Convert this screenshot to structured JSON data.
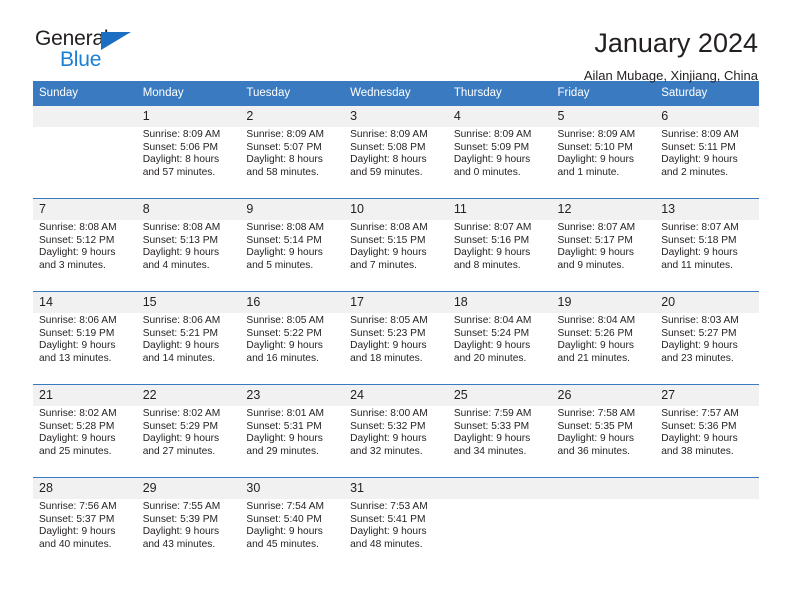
{
  "brand": {
    "line1": "General",
    "line2": "Blue",
    "triangle_color": "#1b6ec2",
    "line2_color": "#1b7fd4"
  },
  "header": {
    "title": "January 2024",
    "location": "Ailan Mubage, Xinjiang, China",
    "header_bg": "#3a7ac0",
    "date_cell_bg": "#f1f1f1"
  },
  "calendar": {
    "weekday_headers": [
      "Sunday",
      "Monday",
      "Tuesday",
      "Wednesday",
      "Thursday",
      "Friday",
      "Saturday"
    ],
    "weeks": [
      [
        {
          "day": "",
          "sunrise": "",
          "sunset": "",
          "daylight_1": "",
          "daylight_2": ""
        },
        {
          "day": "1",
          "sunrise": "Sunrise: 8:09 AM",
          "sunset": "Sunset: 5:06 PM",
          "daylight_1": "Daylight: 8 hours",
          "daylight_2": "and 57 minutes."
        },
        {
          "day": "2",
          "sunrise": "Sunrise: 8:09 AM",
          "sunset": "Sunset: 5:07 PM",
          "daylight_1": "Daylight: 8 hours",
          "daylight_2": "and 58 minutes."
        },
        {
          "day": "3",
          "sunrise": "Sunrise: 8:09 AM",
          "sunset": "Sunset: 5:08 PM",
          "daylight_1": "Daylight: 8 hours",
          "daylight_2": "and 59 minutes."
        },
        {
          "day": "4",
          "sunrise": "Sunrise: 8:09 AM",
          "sunset": "Sunset: 5:09 PM",
          "daylight_1": "Daylight: 9 hours",
          "daylight_2": "and 0 minutes."
        },
        {
          "day": "5",
          "sunrise": "Sunrise: 8:09 AM",
          "sunset": "Sunset: 5:10 PM",
          "daylight_1": "Daylight: 9 hours",
          "daylight_2": "and 1 minute."
        },
        {
          "day": "6",
          "sunrise": "Sunrise: 8:09 AM",
          "sunset": "Sunset: 5:11 PM",
          "daylight_1": "Daylight: 9 hours",
          "daylight_2": "and 2 minutes."
        }
      ],
      [
        {
          "day": "7",
          "sunrise": "Sunrise: 8:08 AM",
          "sunset": "Sunset: 5:12 PM",
          "daylight_1": "Daylight: 9 hours",
          "daylight_2": "and 3 minutes."
        },
        {
          "day": "8",
          "sunrise": "Sunrise: 8:08 AM",
          "sunset": "Sunset: 5:13 PM",
          "daylight_1": "Daylight: 9 hours",
          "daylight_2": "and 4 minutes."
        },
        {
          "day": "9",
          "sunrise": "Sunrise: 8:08 AM",
          "sunset": "Sunset: 5:14 PM",
          "daylight_1": "Daylight: 9 hours",
          "daylight_2": "and 5 minutes."
        },
        {
          "day": "10",
          "sunrise": "Sunrise: 8:08 AM",
          "sunset": "Sunset: 5:15 PM",
          "daylight_1": "Daylight: 9 hours",
          "daylight_2": "and 7 minutes."
        },
        {
          "day": "11",
          "sunrise": "Sunrise: 8:07 AM",
          "sunset": "Sunset: 5:16 PM",
          "daylight_1": "Daylight: 9 hours",
          "daylight_2": "and 8 minutes."
        },
        {
          "day": "12",
          "sunrise": "Sunrise: 8:07 AM",
          "sunset": "Sunset: 5:17 PM",
          "daylight_1": "Daylight: 9 hours",
          "daylight_2": "and 9 minutes."
        },
        {
          "day": "13",
          "sunrise": "Sunrise: 8:07 AM",
          "sunset": "Sunset: 5:18 PM",
          "daylight_1": "Daylight: 9 hours",
          "daylight_2": "and 11 minutes."
        }
      ],
      [
        {
          "day": "14",
          "sunrise": "Sunrise: 8:06 AM",
          "sunset": "Sunset: 5:19 PM",
          "daylight_1": "Daylight: 9 hours",
          "daylight_2": "and 13 minutes."
        },
        {
          "day": "15",
          "sunrise": "Sunrise: 8:06 AM",
          "sunset": "Sunset: 5:21 PM",
          "daylight_1": "Daylight: 9 hours",
          "daylight_2": "and 14 minutes."
        },
        {
          "day": "16",
          "sunrise": "Sunrise: 8:05 AM",
          "sunset": "Sunset: 5:22 PM",
          "daylight_1": "Daylight: 9 hours",
          "daylight_2": "and 16 minutes."
        },
        {
          "day": "17",
          "sunrise": "Sunrise: 8:05 AM",
          "sunset": "Sunset: 5:23 PM",
          "daylight_1": "Daylight: 9 hours",
          "daylight_2": "and 18 minutes."
        },
        {
          "day": "18",
          "sunrise": "Sunrise: 8:04 AM",
          "sunset": "Sunset: 5:24 PM",
          "daylight_1": "Daylight: 9 hours",
          "daylight_2": "and 20 minutes."
        },
        {
          "day": "19",
          "sunrise": "Sunrise: 8:04 AM",
          "sunset": "Sunset: 5:26 PM",
          "daylight_1": "Daylight: 9 hours",
          "daylight_2": "and 21 minutes."
        },
        {
          "day": "20",
          "sunrise": "Sunrise: 8:03 AM",
          "sunset": "Sunset: 5:27 PM",
          "daylight_1": "Daylight: 9 hours",
          "daylight_2": "and 23 minutes."
        }
      ],
      [
        {
          "day": "21",
          "sunrise": "Sunrise: 8:02 AM",
          "sunset": "Sunset: 5:28 PM",
          "daylight_1": "Daylight: 9 hours",
          "daylight_2": "and 25 minutes."
        },
        {
          "day": "22",
          "sunrise": "Sunrise: 8:02 AM",
          "sunset": "Sunset: 5:29 PM",
          "daylight_1": "Daylight: 9 hours",
          "daylight_2": "and 27 minutes."
        },
        {
          "day": "23",
          "sunrise": "Sunrise: 8:01 AM",
          "sunset": "Sunset: 5:31 PM",
          "daylight_1": "Daylight: 9 hours",
          "daylight_2": "and 29 minutes."
        },
        {
          "day": "24",
          "sunrise": "Sunrise: 8:00 AM",
          "sunset": "Sunset: 5:32 PM",
          "daylight_1": "Daylight: 9 hours",
          "daylight_2": "and 32 minutes."
        },
        {
          "day": "25",
          "sunrise": "Sunrise: 7:59 AM",
          "sunset": "Sunset: 5:33 PM",
          "daylight_1": "Daylight: 9 hours",
          "daylight_2": "and 34 minutes."
        },
        {
          "day": "26",
          "sunrise": "Sunrise: 7:58 AM",
          "sunset": "Sunset: 5:35 PM",
          "daylight_1": "Daylight: 9 hours",
          "daylight_2": "and 36 minutes."
        },
        {
          "day": "27",
          "sunrise": "Sunrise: 7:57 AM",
          "sunset": "Sunset: 5:36 PM",
          "daylight_1": "Daylight: 9 hours",
          "daylight_2": "and 38 minutes."
        }
      ],
      [
        {
          "day": "28",
          "sunrise": "Sunrise: 7:56 AM",
          "sunset": "Sunset: 5:37 PM",
          "daylight_1": "Daylight: 9 hours",
          "daylight_2": "and 40 minutes."
        },
        {
          "day": "29",
          "sunrise": "Sunrise: 7:55 AM",
          "sunset": "Sunset: 5:39 PM",
          "daylight_1": "Daylight: 9 hours",
          "daylight_2": "and 43 minutes."
        },
        {
          "day": "30",
          "sunrise": "Sunrise: 7:54 AM",
          "sunset": "Sunset: 5:40 PM",
          "daylight_1": "Daylight: 9 hours",
          "daylight_2": "and 45 minutes."
        },
        {
          "day": "31",
          "sunrise": "Sunrise: 7:53 AM",
          "sunset": "Sunset: 5:41 PM",
          "daylight_1": "Daylight: 9 hours",
          "daylight_2": "and 48 minutes."
        },
        {
          "day": "",
          "sunrise": "",
          "sunset": "",
          "daylight_1": "",
          "daylight_2": ""
        },
        {
          "day": "",
          "sunrise": "",
          "sunset": "",
          "daylight_1": "",
          "daylight_2": ""
        },
        {
          "day": "",
          "sunrise": "",
          "sunset": "",
          "daylight_1": "",
          "daylight_2": ""
        }
      ]
    ]
  }
}
